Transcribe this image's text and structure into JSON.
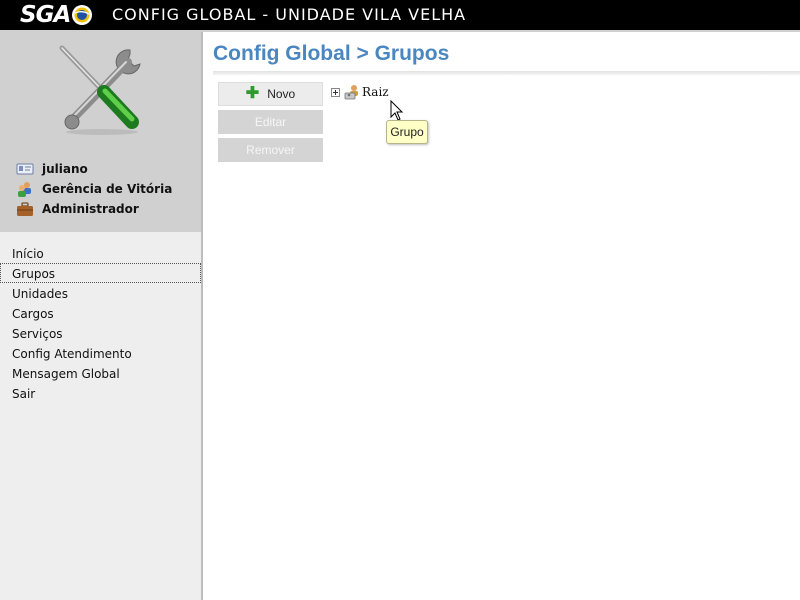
{
  "header": {
    "logo_text": "SGA",
    "title": "CONFIG GLOBAL - UNIDADE VILA VELHA"
  },
  "profile": {
    "image_icon": "tools-icon",
    "user_name": "juliano",
    "user_icon": "id-card-icon",
    "unit_name": "Gerência de Vitória",
    "unit_icon": "people-icon",
    "role_name": "Administrador",
    "role_icon": "briefcase-icon"
  },
  "menu": {
    "items": [
      {
        "label": "Início"
      },
      {
        "label": "Grupos"
      },
      {
        "label": "Unidades"
      },
      {
        "label": "Cargos"
      },
      {
        "label": "Serviços"
      },
      {
        "label": "Config Atendimento"
      },
      {
        "label": "Mensagem Global"
      },
      {
        "label": "Sair"
      }
    ],
    "active": "Grupos"
  },
  "main": {
    "title": "Config Global > Grupos",
    "buttons": {
      "new_label": "Novo",
      "edit_label": "Editar",
      "remove_label": "Remover"
    },
    "tree": {
      "root_label": "Raiz",
      "root_icon": "group-node-icon",
      "expander_icon": "plus-expander-icon"
    },
    "tooltip": "Grupo"
  },
  "colors": {
    "title_blue": "#4a86c0",
    "header_bg": "#000000",
    "sidebar_bg": "#eeeeee",
    "profile_bg": "#d0d0d0",
    "tooltip_bg": "#ffffc8",
    "plus_green": "#2e9a2e"
  }
}
